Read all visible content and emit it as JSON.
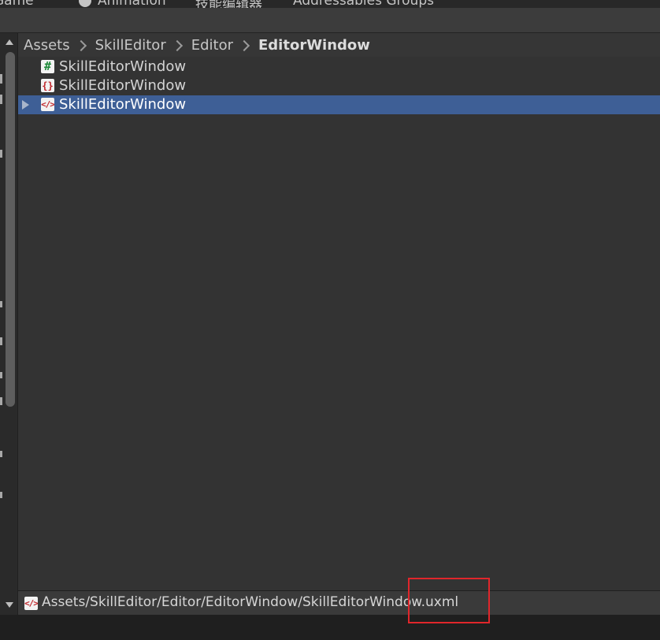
{
  "tabs": [
    {
      "label": "Game"
    },
    {
      "label": "Animation"
    },
    {
      "label": "技能编辑器"
    },
    {
      "label": "Addressables Groups"
    }
  ],
  "breadcrumb": {
    "items": [
      "Assets",
      "SkillEditor",
      "Editor"
    ],
    "current": "EditorWindow"
  },
  "files": [
    {
      "name": "SkillEditorWindow",
      "type": "cs-script",
      "icon_glyph": "#",
      "selected": false
    },
    {
      "name": "SkillEditorWindow",
      "type": "uss-stylesheet",
      "icon_glyph": "{}",
      "selected": false
    },
    {
      "name": "SkillEditorWindow",
      "type": "uxml-document",
      "icon_glyph": "</>",
      "selected": true
    }
  ],
  "pathbar": {
    "icon_glyph": "</>",
    "path": "Assets/SkillEditor/Editor/EditorWindow/SkillEditorWindow.uxml"
  },
  "colors": {
    "selection": "#3e5f96",
    "highlight_box": "#e0262b",
    "cs_icon": "#1f8a3a",
    "uxml_icon": "#c0262b"
  }
}
